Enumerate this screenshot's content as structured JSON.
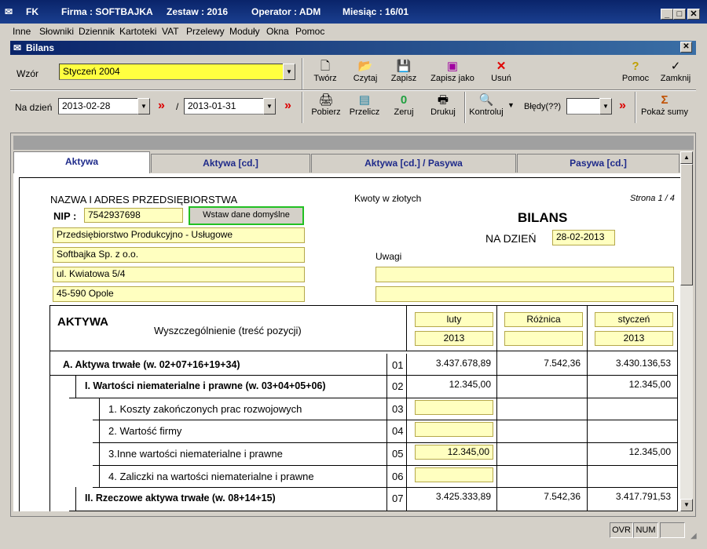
{
  "window": {
    "app": "FK",
    "firma": "Firma : SOFTBAJKA",
    "zestaw": "Zestaw : 2016",
    "operator": "Operator : ADM",
    "miesiac": "Miesiąc : 16/01"
  },
  "menu": [
    "Inne",
    "Słowniki",
    "Dziennik",
    "Kartoteki",
    "VAT",
    "Przelewy",
    "Moduły",
    "Okna",
    "Pomoc"
  ],
  "subwindow": {
    "title": "Bilans"
  },
  "toolbar": {
    "wzor_label": "Wzór",
    "wzor_value": "Styczeń 2004",
    "tworz": "Twórz",
    "czytaj": "Czytaj",
    "zapisz": "Zapisz",
    "zapisz_jako": "Zapisz jako",
    "usun": "Usuń",
    "pomoc": "Pomoc",
    "zamknij": "Zamknij",
    "na_dzien_label": "Na dzień",
    "date1": "2013-02-28",
    "arrows": "»",
    "slash": "/",
    "date2": "2013-01-31",
    "pobierz": "Pobierz",
    "przelicz": "Przelicz",
    "zeruj": "Zeruj",
    "drukuj": "Drukuj",
    "kontroluj": "Kontroluj",
    "bledy": "Błędy(??)",
    "pokaz_sumy": "Pokaż sumy"
  },
  "tabs": [
    "Aktywa",
    "Aktywa [cd.]",
    "Aktywa [cd.] / Pasywa",
    "Pasywa [cd.]"
  ],
  "doc": {
    "company_header": "NAZWA I ADRES PRZEDSIĘBIORSTWA",
    "nip_label": "NIP :",
    "nip": "7542937698",
    "insert_default": "Wstaw dane domyślne",
    "addr1": "Przedsiębiorstwo Produkcyjno - Usługowe",
    "addr2": "Softbajka Sp. z o.o.",
    "addr3": "ul. Kwiatowa 5/4",
    "addr4": "45-590 Opole",
    "kwoty": "Kwoty w złotych",
    "strona": "Strona 1 / 4",
    "bilans": "BILANS",
    "na_dzien": "NA DZIEŃ",
    "na_dzien_val": "28-02-2013",
    "uwagi": "Uwagi",
    "aktywa": "AKTYWA",
    "wyszczegolnienie": "Wyszczególnienie (treść pozycji)",
    "col1_top": "luty",
    "col1_bot": "2013",
    "col2_top": "Różnica",
    "col3_top": "styczeń",
    "col3_bot": "2013"
  },
  "rows": [
    {
      "label": "A. Aktywa trwałe  (w. 02+07+16+19+34)",
      "nr": "01",
      "v1": "3.437.678,89",
      "v2": "7.542,36",
      "v3": "3.430.136,53"
    },
    {
      "label": "I. Wartości niematerialne i prawne (w. 03+04+05+06)",
      "nr": "02",
      "v1": "12.345,00",
      "v2": "",
      "v3": "12.345,00"
    },
    {
      "label": "1. Koszty zakończonych prac rozwojowych",
      "nr": "03",
      "v1": "",
      "v2": "",
      "v3": ""
    },
    {
      "label": "2. Wartość firmy",
      "nr": "04",
      "v1": "",
      "v2": "",
      "v3": ""
    },
    {
      "label": "3.Inne wartości niematerialne i prawne",
      "nr": "05",
      "v1": "12.345,00",
      "v2": "",
      "v3": "12.345,00"
    },
    {
      "label": "4. Zaliczki na wartości niematerialne i prawne",
      "nr": "06",
      "v1": "",
      "v2": "",
      "v3": ""
    },
    {
      "label": "II. Rzeczowe aktywa trwałe (w. 08+14+15)",
      "nr": "07",
      "v1": "3.425.333,89",
      "v2": "7.542,36",
      "v3": "3.417.791,53"
    }
  ],
  "status": {
    "ovr": "OVR",
    "num": "NUM"
  }
}
